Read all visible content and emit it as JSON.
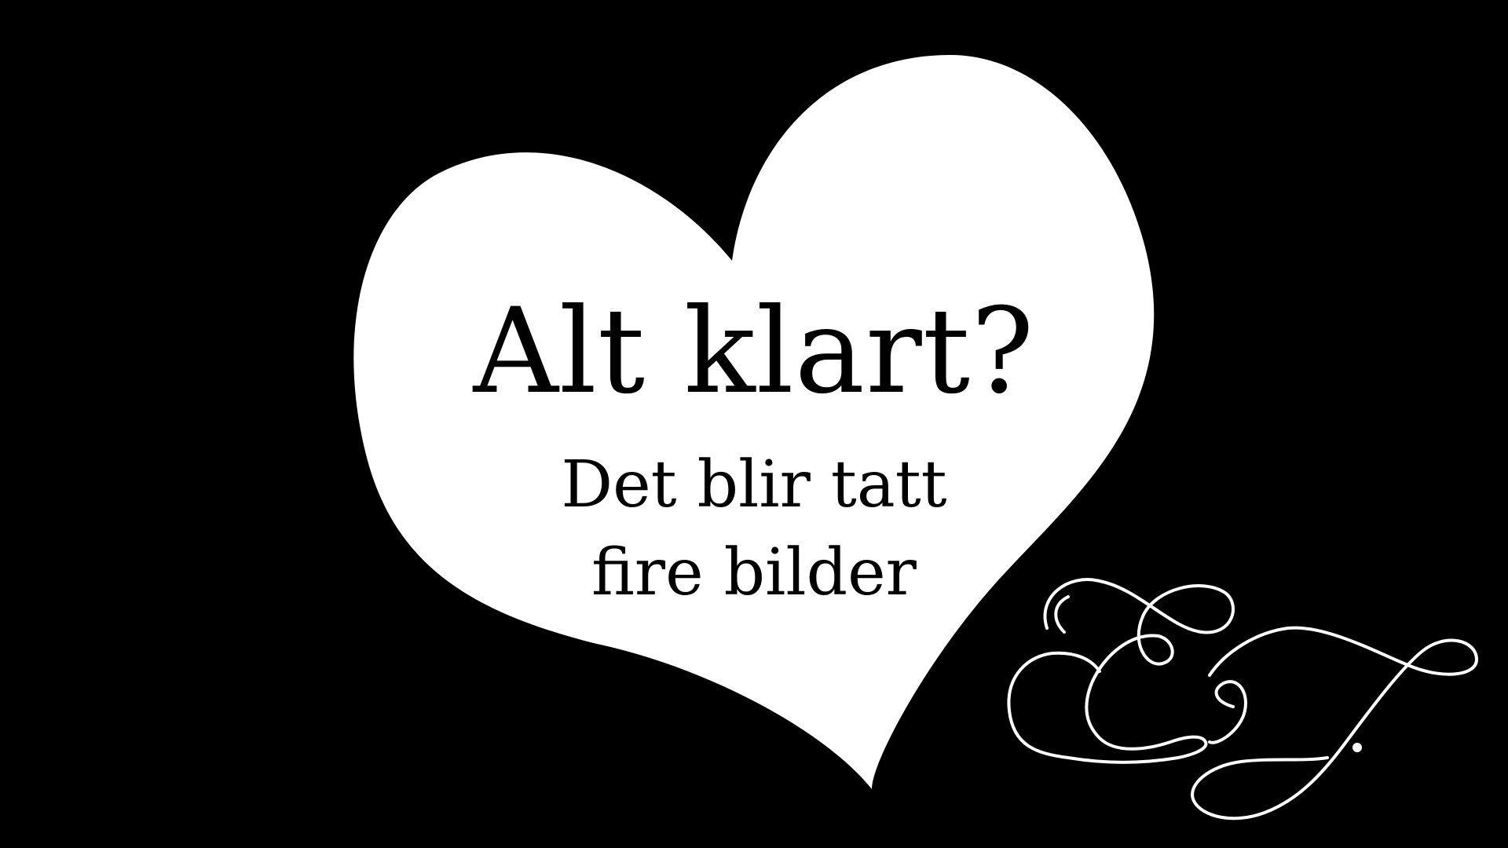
{
  "slide": {
    "headline": "Alt klart?",
    "subline_1": "Det blir tatt",
    "subline_2": "fire bilder",
    "monogram": "EJ"
  },
  "colors": {
    "background": "#000000",
    "heart": "#ffffff",
    "text": "#000000",
    "monogram_stroke": "#ffffff"
  },
  "icons": {
    "heart": "heart-shape",
    "monogram": "decorative-monogram"
  }
}
